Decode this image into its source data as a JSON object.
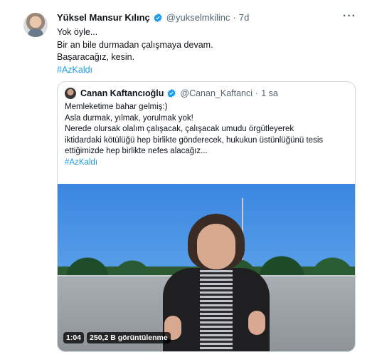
{
  "tweet": {
    "author_name": "Yüksel Mansur Kılınç",
    "author_handle": "@yukselmkilinc",
    "separator": "·",
    "time": "7d",
    "more": "···",
    "lines": [
      "Yok öyle...",
      "Bir an bile durmadan çalışmaya devam.",
      "Başaracağız, kesin."
    ],
    "hashtag": "#AzKaldı"
  },
  "quote": {
    "author_name": "Canan Kaftancıoğlu",
    "author_handle": "@Canan_Kaftanci",
    "separator": "·",
    "time": "1 sa",
    "lines": [
      "Memleketime bahar gelmiş:)",
      "Asla durmak, yılmak, yorulmak yok!",
      "Nerede olursak olalım çalışacak, çalışacak umudu örgütleyerek",
      "iktidardaki kötülüğü hep birlikte gönderecek, hukukun üstünlüğünü tesis",
      "ettiğimizde hep birlikte nefes alacağız..."
    ],
    "hashtag": "#AzKaldı",
    "video": {
      "duration": "1:04",
      "views": "250,2 B görüntülenme"
    }
  },
  "colors": {
    "verified": "#1d9bf0",
    "link": "#1d9bf0",
    "secondary_text": "#536471",
    "border": "#cfd9de"
  },
  "icons": {
    "verified": "verified-badge-icon",
    "more": "more-options-icon"
  }
}
